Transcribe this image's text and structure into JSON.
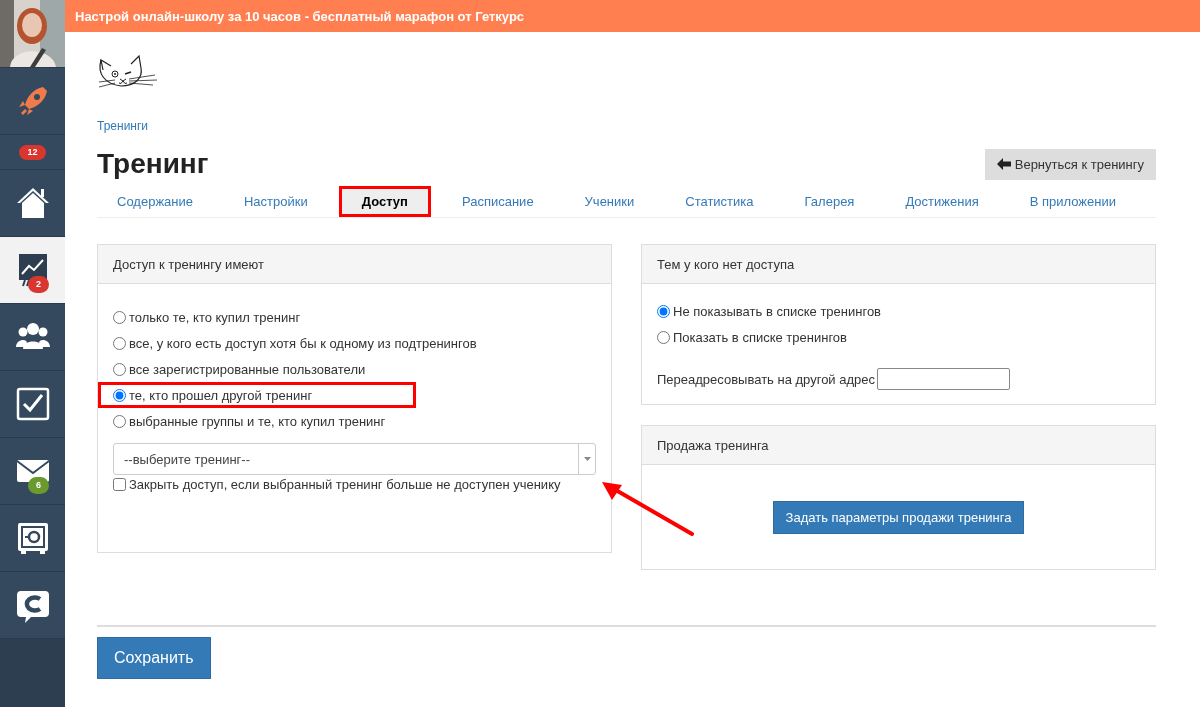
{
  "sidebar": {
    "items": [
      {
        "kind": "avatar"
      },
      {
        "kind": "nav",
        "selected": false
      },
      {
        "kind": "counter",
        "badge": "12",
        "color": "#d9362f"
      },
      {
        "kind": "nav",
        "selected": false
      },
      {
        "kind": "nav",
        "selected": true,
        "badge": "2",
        "color": "#d9362f"
      },
      {
        "kind": "nav",
        "selected": false
      },
      {
        "kind": "nav",
        "selected": false
      },
      {
        "kind": "nav",
        "selected": false,
        "badge": "6",
        "color": "#6a9a2e"
      },
      {
        "kind": "nav",
        "selected": false
      },
      {
        "kind": "nav",
        "selected": false
      }
    ]
  },
  "banner": "Настрой онлайн-школу за 10 часов - бесплатный марафон от Геткурс",
  "breadcrumb": "Тренинги",
  "title": "Тренинг",
  "back_button": "Вернуться к тренингу",
  "tabs": [
    {
      "label": "Содержание",
      "selected": false,
      "highlighted": false
    },
    {
      "label": "Настройки",
      "selected": false,
      "highlighted": false
    },
    {
      "label": "Доступ",
      "selected": true,
      "highlighted": true
    },
    {
      "label": "Расписание",
      "selected": false,
      "highlighted": false
    },
    {
      "label": "Ученики",
      "selected": false,
      "highlighted": false
    },
    {
      "label": "Статистика",
      "selected": false,
      "highlighted": false
    },
    {
      "label": "Галерея",
      "selected": false,
      "highlighted": false
    },
    {
      "label": "Достижения",
      "selected": false,
      "highlighted": false
    },
    {
      "label": "В приложении",
      "selected": false,
      "highlighted": false
    }
  ],
  "access_panel": {
    "title": "Доступ к тренингу имеют",
    "options": [
      {
        "label": "только те, кто купил тренинг",
        "selected": false,
        "highlighted": false
      },
      {
        "label": "все, у кого есть доступ хотя бы к одному из подтренингов",
        "selected": false,
        "highlighted": false
      },
      {
        "label": "все зарегистрированные пользователи",
        "selected": false,
        "highlighted": false
      },
      {
        "label": "те, кто прошел другой тренинг",
        "selected": true,
        "highlighted": true
      },
      {
        "label": "выбранные группы и те, кто купил тренинг",
        "selected": false,
        "highlighted": false
      }
    ],
    "select": {
      "value": "--выберите тренинг--"
    },
    "checkbox": {
      "label": "Закрыть доступ, если выбранный тренинг больше не доступен ученику",
      "checked": false
    }
  },
  "no_access_panel": {
    "title": "Тем у кого нет доступа",
    "options": [
      {
        "label": "Не показывать в списке тренингов",
        "selected": true
      },
      {
        "label": "Показать в списке тренингов",
        "selected": false
      }
    ],
    "redirect_label": "Переадресовывать на другой адрес"
  },
  "sale_panel": {
    "title": "Продажа тренинга",
    "button": "Задать параметры продажи тренинга"
  },
  "save_button": "Сохранить"
}
